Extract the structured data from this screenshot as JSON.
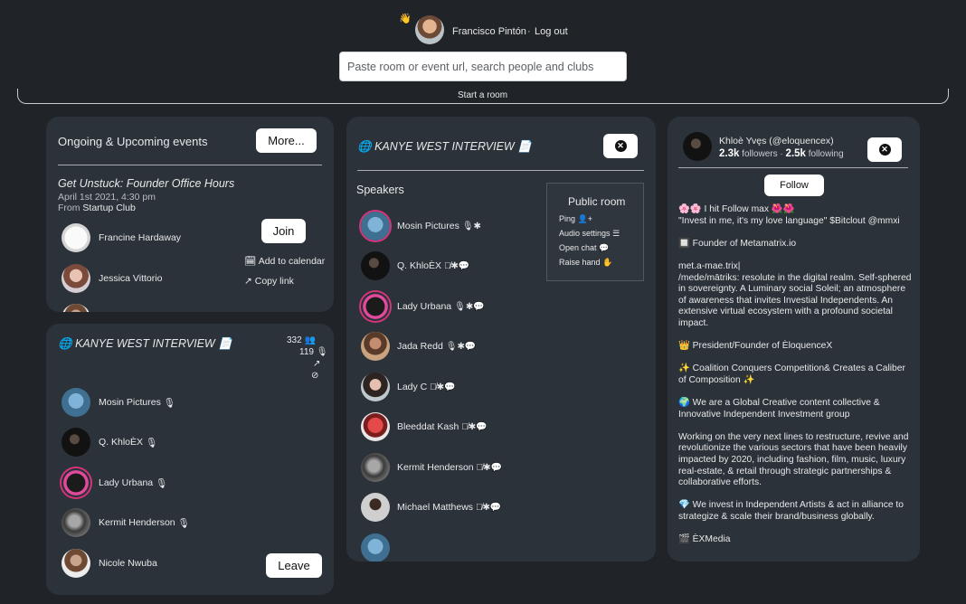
{
  "header": {
    "wave_emoji": "👋",
    "user_name": "Francisco Pintón",
    "separator": "·",
    "logout_label": "Log out",
    "search_placeholder": "Paste room or event url, search people and clubs",
    "start_room_label": "Start a room"
  },
  "events": {
    "heading": "Ongoing & Upcoming events",
    "more_label": "More...",
    "event_title": "Get Unstuck: Founder Office Hours",
    "event_date": "April 1st 2021, 4:30 pm",
    "from_prefix": "From",
    "club": "Startup Club",
    "join_label": "Join",
    "add_calendar_label": "Add to calendar",
    "copy_link_label": "Copy link",
    "people": [
      "Francine Hardaway",
      "Jessica Vittorio"
    ]
  },
  "current_room": {
    "title": "KANYE WEST INTERVIEW",
    "listeners": "332",
    "speakers_count": "119",
    "people": [
      "Mosin Pictures",
      "Q. KhloÈX",
      "Lady Urbana",
      "Kermit Henderson",
      "Nicole Nwuba"
    ],
    "leave_label": "Leave"
  },
  "room_view": {
    "title": "KANYE WEST INTERVIEW",
    "speakers_label": "Speakers",
    "speakers": [
      {
        "name": "Mosin Pictures",
        "icons": "🎙✱"
      },
      {
        "name": "Q. KhloÈX",
        "icons": "🎙̸✱💬"
      },
      {
        "name": "Lady Urbana",
        "icons": "🎙✱💬"
      },
      {
        "name": "Jada Redd",
        "icons": "🎙✱💬"
      },
      {
        "name": "Lady C",
        "icons": "🎙̸✱💬"
      },
      {
        "name": "Bleeddat Kash",
        "icons": "🎙̸✱💬"
      },
      {
        "name": "Kermit Henderson",
        "icons": "🎙̸✱💬"
      },
      {
        "name": "Michael Matthews",
        "icons": "🎙̸✱💬"
      }
    ],
    "menu": {
      "title": "Public room",
      "items": [
        "Ping",
        "Audio settings",
        "Open chat",
        "Raise hand"
      ]
    }
  },
  "profile": {
    "name": "Khloè Yvęs (@eloquencex)",
    "followers": "2.3k",
    "followers_label": "followers",
    "dot": "·",
    "following": "2.5k",
    "following_label": "following",
    "follow_label": "Follow",
    "bio": [
      "🌸🌸 I hit Follow max 🌺🌺\n\"Invest in me, it's my love language\" $Bitclout @mmxi",
      "🔲 Founder of Metamatrix.io",
      "met.a-mae.trix|\n/mede/mātriks: resolute in the digital realm. Self-sphered in sovereignty.  A Luminary social Soleil; an atmosphere of awareness that invites Investial Independents. An extensive virtual ecosystem with a profound societal impact.",
      "👑 President/Founder of ÈloquenceX",
      "✨ Coalition Conquers Competition& Creates a Caliber of Composition ✨",
      "🌍  We are a Global Creative content collective & Innovative Independent Investment group",
      "Working on the very next lines to restructure, revive and revolutionize the various sectors that have been heavily impacted by 2020, including fashion, film, music, luxury real-estate, & retail through strategic partnerships & collaborative efforts.",
      "💎 We invest in Independent Artists & act in alliance to strategize & scale their brand/business globally.",
      "🎬 ÈXMedia"
    ]
  },
  "colors": {
    "background": "#202327",
    "panel": "#2b3239",
    "speaker_ring": "#d8337a"
  }
}
